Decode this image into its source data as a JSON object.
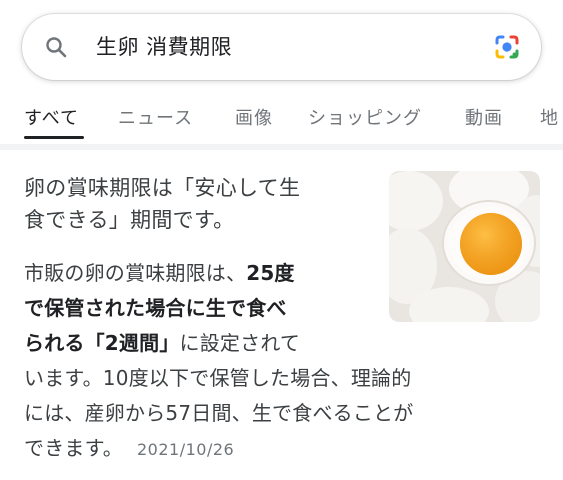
{
  "search": {
    "query": "生卵 消費期限"
  },
  "tabs": [
    {
      "label": "すべて",
      "active": true
    },
    {
      "label": "ニュース",
      "active": false
    },
    {
      "label": "画像",
      "active": false
    },
    {
      "label": "ショッピング",
      "active": false
    },
    {
      "label": "動画",
      "active": false
    },
    {
      "label": "地",
      "active": false
    }
  ],
  "snippet": {
    "title_line1": "卵の賞味期限は「安心して生",
    "title_line2": "食できる」期間です。",
    "body": {
      "l1_normal": "市販の卵の賞味期限は、",
      "l1_bold": "25度",
      "l2_bold": "で保管された場合に生で食べ",
      "l3_bold": "られる「2週間」",
      "l3_normal": "に設定されて",
      "l4": "います。10度以下で保管した場合、理論的",
      "l5": "には、産卵から57日間、生で食べることが",
      "l6": "できます。"
    },
    "date": "2021/10/26",
    "image_alt": "eggs-photo"
  },
  "colors": {
    "text": "#202124",
    "muted": "#70757a",
    "yolk": "#f4a21e"
  }
}
